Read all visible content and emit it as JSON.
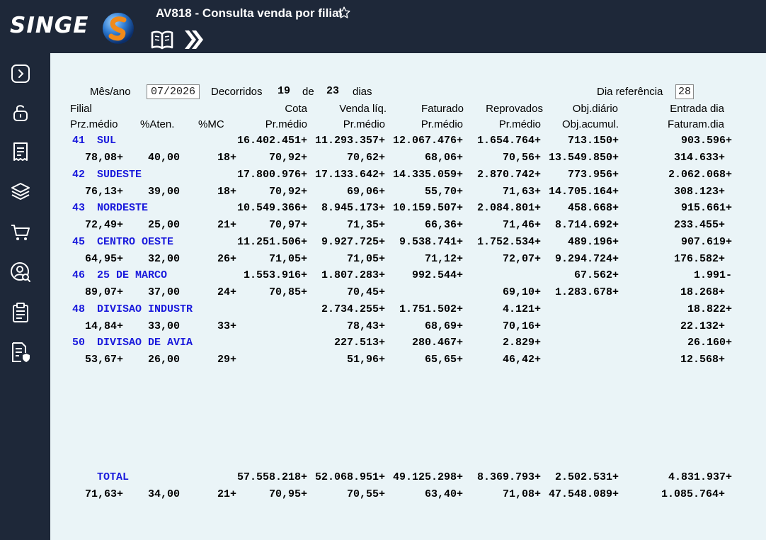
{
  "app": {
    "logo": "SINGE",
    "title": "AV818 - Consulta venda por filial"
  },
  "sidebar": {
    "icons": [
      "expand-icon",
      "unlock-icon",
      "receipt-icon",
      "layers-icon",
      "cart-icon",
      "user-search-icon",
      "clipboard-icon",
      "secure-document-icon"
    ]
  },
  "header": {
    "mes_label": "Mês/ano",
    "mes_value": "07/2026",
    "decorridos_label": "Decorridos",
    "decorridos_value": "19",
    "de_label": "de",
    "total_days": "23",
    "dias_label": "dias",
    "dia_ref_label": "Dia referência",
    "dia_ref_value": "28"
  },
  "columns": {
    "row1": [
      "Filial",
      "Cota",
      "Venda líq.",
      "Faturado",
      "Reprovados",
      "Obj.diário",
      "Entrada dia"
    ],
    "row2": [
      "Prz.médio",
      "%Aten.",
      "%MC",
      "Pr.médio",
      "Pr.médio",
      "Pr.médio",
      "Pr.médio",
      "Obj.acumul.",
      "Faturam.dia"
    ]
  },
  "rows": [
    {
      "code": "41",
      "name": "SUL",
      "cota": "16.402.451+",
      "venda": "11.293.357+",
      "faturado": "12.067.476+",
      "reprovados": "1.654.764+",
      "obj_diario": "713.150+",
      "entrada": "903.596+",
      "prz": "78,08+",
      "aten": "40,00",
      "mc": "18+",
      "pm1": "70,92+",
      "pm2": "70,62+",
      "pm3": "68,06+",
      "pm4": "70,56+",
      "obj_acum": "13.549.850+",
      "fat_dia": "314.633+"
    },
    {
      "code": "42",
      "name": "SUDESTE",
      "cota": "17.800.976+",
      "venda": "17.133.642+",
      "faturado": "14.335.059+",
      "reprovados": "2.870.742+",
      "obj_diario": "773.956+",
      "entrada": "2.062.068+",
      "prz": "76,13+",
      "aten": "39,00",
      "mc": "18+",
      "pm1": "70,92+",
      "pm2": "69,06+",
      "pm3": "55,70+",
      "pm4": "71,63+",
      "obj_acum": "14.705.164+",
      "fat_dia": "308.123+"
    },
    {
      "code": "43",
      "name": "NORDESTE",
      "cota": "10.549.366+",
      "venda": "8.945.173+",
      "faturado": "10.159.507+",
      "reprovados": "2.084.801+",
      "obj_diario": "458.668+",
      "entrada": "915.661+",
      "prz": "72,49+",
      "aten": "25,00",
      "mc": "21+",
      "pm1": "70,97+",
      "pm2": "71,35+",
      "pm3": "66,36+",
      "pm4": "71,46+",
      "obj_acum": "8.714.692+",
      "fat_dia": "233.455+"
    },
    {
      "code": "45",
      "name": "CENTRO OESTE",
      "cota": "11.251.506+",
      "venda": "9.927.725+",
      "faturado": "9.538.741+",
      "reprovados": "1.752.534+",
      "obj_diario": "489.196+",
      "entrada": "907.619+",
      "prz": "64,95+",
      "aten": "32,00",
      "mc": "26+",
      "pm1": "71,05+",
      "pm2": "71,05+",
      "pm3": "71,12+",
      "pm4": "72,07+",
      "obj_acum": "9.294.724+",
      "fat_dia": "176.582+"
    },
    {
      "code": "46",
      "name": "25 DE MARCO",
      "cota": "1.553.916+",
      "venda": "1.807.283+",
      "faturado": "992.544+",
      "reprovados": "",
      "obj_diario": "67.562+",
      "entrada": "1.991-",
      "prz": "89,07+",
      "aten": "37,00",
      "mc": "24+",
      "pm1": "70,85+",
      "pm2": "70,45+",
      "pm3": "",
      "pm4": "69,10+",
      "obj_acum": "1.283.678+",
      "fat_dia": "18.268+"
    },
    {
      "code": "48",
      "name": "DIVISAO INDUSTR",
      "cota": "",
      "venda": "2.734.255+",
      "faturado": "1.751.502+",
      "reprovados": "4.121+",
      "obj_diario": "",
      "entrada": "18.822+",
      "prz": "14,84+",
      "aten": "33,00",
      "mc": "33+",
      "pm1": "",
      "pm2": "78,43+",
      "pm3": "68,69+",
      "pm4": "70,16+",
      "obj_acum": "",
      "fat_dia": "22.132+"
    },
    {
      "code": "50",
      "name": "DIVISAO DE AVIA",
      "cota": "",
      "venda": "227.513+",
      "faturado": "280.467+",
      "reprovados": "2.829+",
      "obj_diario": "",
      "entrada": "26.160+",
      "prz": "53,67+",
      "aten": "26,00",
      "mc": "29+",
      "pm1": "",
      "pm2": "51,96+",
      "pm3": "65,65+",
      "pm4": "46,42+",
      "obj_acum": "",
      "fat_dia": "12.568+"
    }
  ],
  "total": {
    "name": "TOTAL",
    "cota": "57.558.218+",
    "venda": "52.068.951+",
    "faturado": "49.125.298+",
    "reprovados": "8.369.793+",
    "obj_diario": "2.502.531+",
    "entrada": "4.831.937+",
    "prz": "71,63+",
    "aten": "34,00",
    "mc": "21+",
    "pm1": "70,95+",
    "pm2": "70,55+",
    "pm3": "63,40+",
    "pm4": "71,08+",
    "obj_acum": "47.548.089+",
    "fat_dia": "1.085.764+"
  },
  "colors": {
    "background": "#1e2839",
    "content": "#eaf4f7",
    "link": "#1a1adc"
  }
}
